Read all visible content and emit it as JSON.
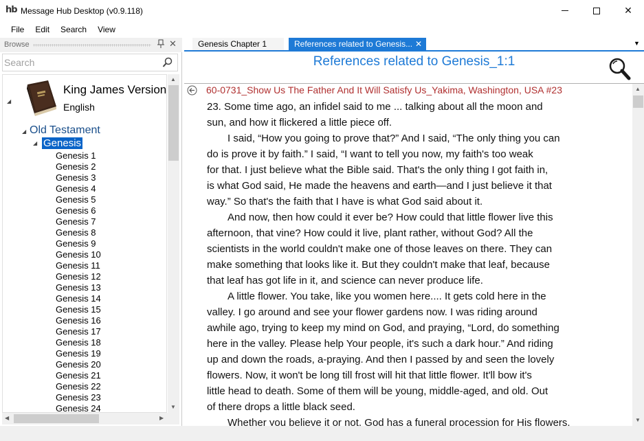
{
  "window": {
    "logo_text": "hb",
    "title": "Message Hub Desktop (v0.9.118)"
  },
  "menu": [
    "File",
    "Edit",
    "Search",
    "View"
  ],
  "browse": {
    "title": "Browse",
    "search_placeholder": "Search",
    "bible": {
      "name": "King James Version",
      "language": "English"
    },
    "testament": "Old Testament",
    "book": "Genesis",
    "chapters": [
      "Genesis 1",
      "Genesis 2",
      "Genesis 3",
      "Genesis 4",
      "Genesis 5",
      "Genesis 6",
      "Genesis 7",
      "Genesis 8",
      "Genesis 9",
      "Genesis 10",
      "Genesis 11",
      "Genesis 12",
      "Genesis 13",
      "Genesis 14",
      "Genesis 15",
      "Genesis 16",
      "Genesis 17",
      "Genesis 18",
      "Genesis 19",
      "Genesis 20",
      "Genesis 21",
      "Genesis 22",
      "Genesis 23",
      "Genesis 24"
    ]
  },
  "tabs": [
    {
      "label": "Genesis Chapter 1",
      "active": false
    },
    {
      "label": "References related to Genesis...",
      "active": true
    }
  ],
  "references": {
    "title": "References related to Genesis_1:1",
    "source": "60-0731_Show Us The Father And It Will Satisfy Us_Yakima, Washington, USA #23",
    "lines": [
      {
        "text": "23.  Some time ago, an infidel said to me ... talking about all the moon and",
        "indent": false
      },
      {
        "text": "sun, and how it flickered a little piece off.",
        "indent": false
      },
      {
        "text": "I said, “How you going to prove that?” And I said, “The only thing you can",
        "indent": true
      },
      {
        "text": "do is prove it by faith.” I said, “I want to tell you now, my faith's too weak",
        "indent": false
      },
      {
        "text": "for that. I just believe what the Bible said. That's the only thing I got faith in,",
        "indent": false
      },
      {
        "text": "is what God said, He made the heavens and earth—and I just believe it that",
        "indent": false
      },
      {
        "text": "way.” So that's the faith that I have is what God said about it.",
        "indent": false
      },
      {
        "text": "And now, then how could it ever be? How could that little flower live this",
        "indent": true
      },
      {
        "text": "afternoon, that vine? How could it live, plant rather, without God? All the",
        "indent": false
      },
      {
        "text": "scientists in the world couldn't make one of those leaves on there. They can",
        "indent": false
      },
      {
        "text": "make something that looks like it. But they couldn't make that leaf, because",
        "indent": false
      },
      {
        "text": "that leaf has got life in it, and science can never produce life.",
        "indent": false
      },
      {
        "text": "A little flower. You take, like you women here.... It gets cold here in the",
        "indent": true
      },
      {
        "text": "valley. I go around and see your flower gardens now. I was riding around",
        "indent": false
      },
      {
        "text": "awhile ago, trying to keep my mind on God, and praying, “Lord, do something",
        "indent": false
      },
      {
        "text": "here in the valley. Please help Your people, it's such a dark hour.” And riding",
        "indent": false
      },
      {
        "text": "up and down the roads, a-praying. And then I passed by and seen the lovely",
        "indent": false
      },
      {
        "text": "flowers. Now, it won't be long till frost will hit that little flower. It'll bow it's",
        "indent": false
      },
      {
        "text": "little head to death. Some of them will be young, middle-aged, and old. Out",
        "indent": false
      },
      {
        "text": "of there drops a little black seed.",
        "indent": false
      },
      {
        "text": "Whether you believe it or not, God has a funeral procession for His flowers.",
        "indent": true
      }
    ]
  },
  "colors": {
    "accent": "#1e7ad6",
    "source_red": "#b03030",
    "tree_blue": "#1a4f8b"
  }
}
